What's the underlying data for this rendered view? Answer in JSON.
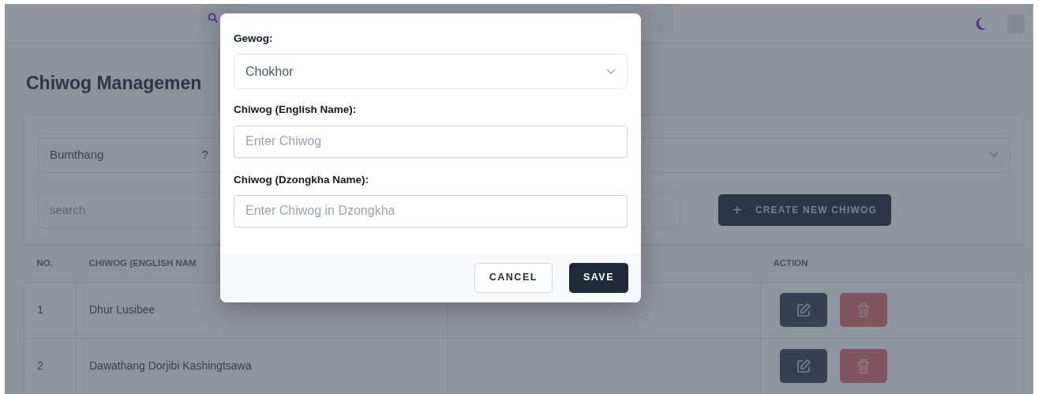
{
  "page": {
    "title": "Chiwog Managemen",
    "filters": [
      {
        "kind": "select",
        "value": "Bumthang",
        "hint": "?"
      },
      {
        "kind": "select-empty"
      }
    ],
    "search": {
      "placeholder": "search"
    },
    "create_button": {
      "icon": "+",
      "label": "CREATE NEW CHIWOG"
    },
    "table": {
      "columns": [
        "NO.",
        "CHIWOG (ENGLISH NAM",
        "",
        "ACTION"
      ],
      "rows": [
        {
          "no": "1",
          "name": "Dhur Lusibee"
        },
        {
          "no": "2",
          "name": "Dawathang Dorjibi Kashingtsawa"
        }
      ]
    }
  },
  "modal": {
    "fields": [
      {
        "kind": "select",
        "label": "Gewog:",
        "value": "Chokhor"
      },
      {
        "kind": "text",
        "label": "Chiwog (English Name):",
        "placeholder": "Enter Chiwog"
      },
      {
        "kind": "text",
        "label": "Chiwog (Dzongkha Name):",
        "placeholder": "Enter Chiwog in Dzongkha"
      }
    ],
    "buttons": [
      {
        "kind": "secondary",
        "label": "CANCEL"
      },
      {
        "kind": "primary",
        "label": "SAVE"
      }
    ]
  }
}
